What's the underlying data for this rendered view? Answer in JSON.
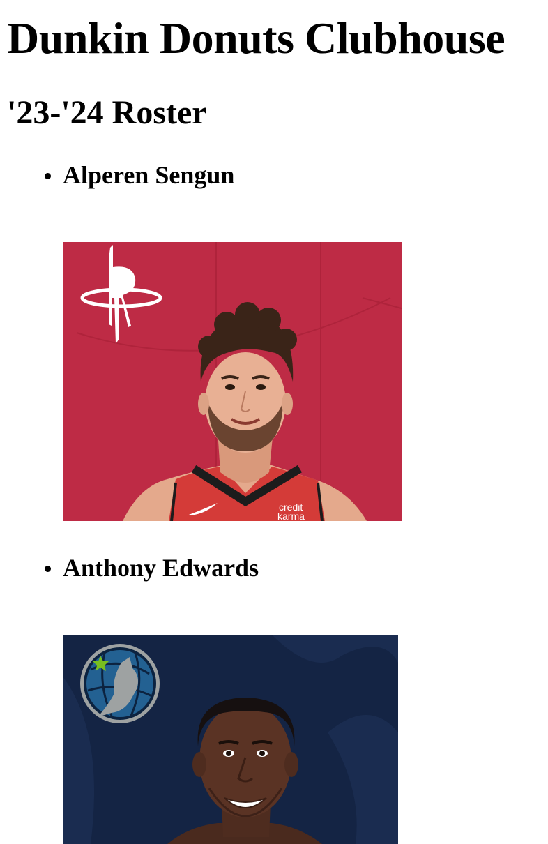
{
  "header": {
    "site_title": "Dunkin Donuts Clubhouse",
    "roster_title": "'23-'24 Roster"
  },
  "roster": [
    {
      "name": "Alperen Sengun",
      "team_logo_icon": "rockets-r-logo-icon",
      "photo_background": "#be2b45",
      "jersey_color": "#d43b38",
      "jersey_text": "credit karma"
    },
    {
      "name": "Anthony Edwards",
      "team_logo_icon": "timberwolves-logo-icon",
      "photo_background": "#142444",
      "jersey_color": "#0c2340"
    }
  ]
}
